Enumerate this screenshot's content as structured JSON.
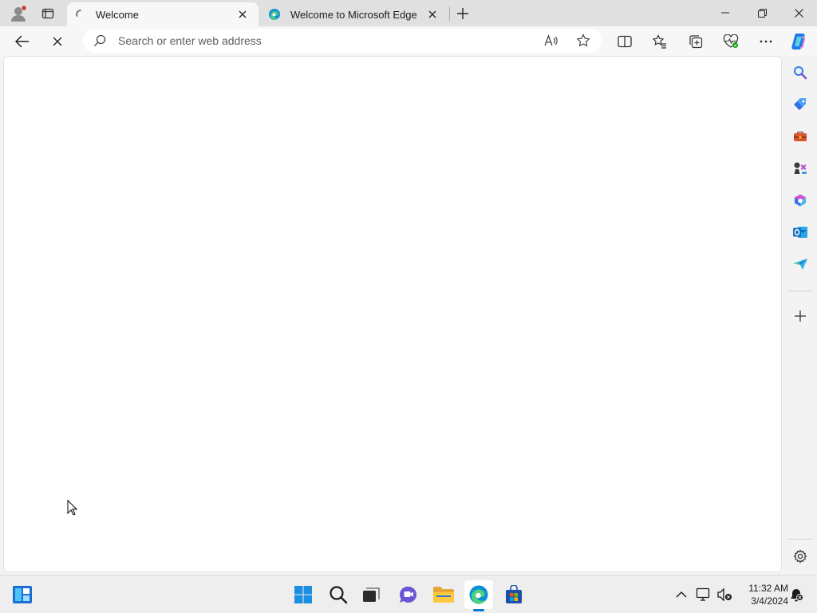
{
  "browser": {
    "tabs": [
      {
        "title": "Welcome",
        "state": "loading",
        "active": true
      },
      {
        "title": "Welcome to Microsoft Edge",
        "icon": "edge-logo-icon",
        "active": false
      }
    ],
    "address_bar": {
      "placeholder": "Search or enter web address",
      "value": ""
    },
    "colors": {
      "accent": "#0078d4",
      "tab_active": "#f7f7f7",
      "titlebar": "#e0e0e0"
    }
  },
  "taskbar": {
    "time": "11:32 AM",
    "date": "3/4/2024",
    "pinned": [
      "widgets-icon",
      "start-icon",
      "search-icon",
      "task-view-icon",
      "teams-chat-icon",
      "file-explorer-icon",
      "edge-icon",
      "store-icon"
    ]
  }
}
